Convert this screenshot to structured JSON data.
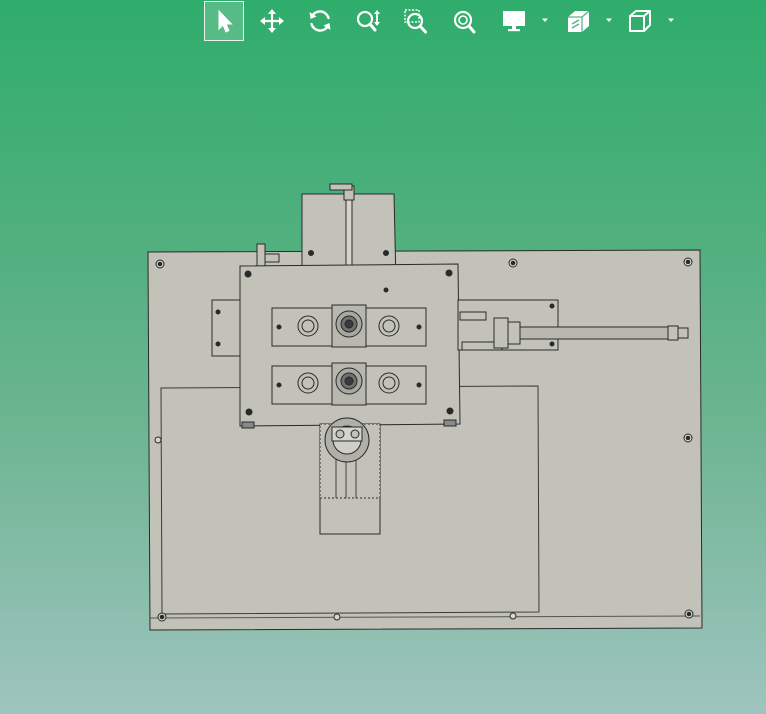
{
  "viewer": {
    "background_top": "#2fad6c",
    "background_bottom": "#9fc4bf",
    "model_fill": "#c2c2b9",
    "model_stroke": "#2a2a2a"
  },
  "toolbar": {
    "items": [
      {
        "id": "select",
        "icon": "cursor-arrow-icon",
        "active": true
      },
      {
        "id": "pan",
        "icon": "move-arrows-icon",
        "active": false
      },
      {
        "id": "rotate",
        "icon": "rotate-icon",
        "active": false
      },
      {
        "id": "zoom",
        "icon": "zoom-updown-icon",
        "active": false
      },
      {
        "id": "zoom-window",
        "icon": "zoom-window-icon",
        "active": false
      },
      {
        "id": "zoom-fit",
        "icon": "zoom-fit-icon",
        "active": false
      },
      {
        "id": "display-mode",
        "icon": "monitor-icon",
        "active": false,
        "dropdown": true
      },
      {
        "id": "section-view",
        "icon": "section-cube-icon",
        "active": false,
        "dropdown": true
      },
      {
        "id": "standard-views",
        "icon": "cube-icon",
        "active": false,
        "dropdown": true
      }
    ]
  }
}
